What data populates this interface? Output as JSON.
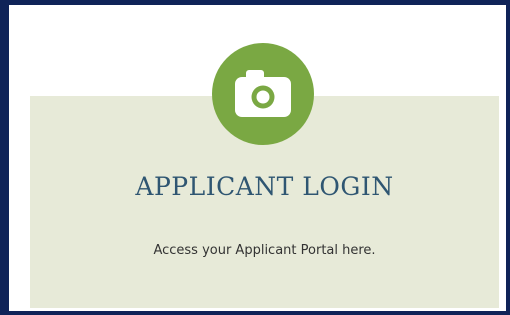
{
  "login_card": {
    "icon": "camera-icon",
    "title": "APPLICANT LOGIN",
    "description": "Access your Applicant Portal here."
  },
  "colors": {
    "border": "#0f2358",
    "card_background": "#e7ead8",
    "icon_circle": "#7aa843",
    "title_text": "#2f5672",
    "body_text": "#333333"
  }
}
